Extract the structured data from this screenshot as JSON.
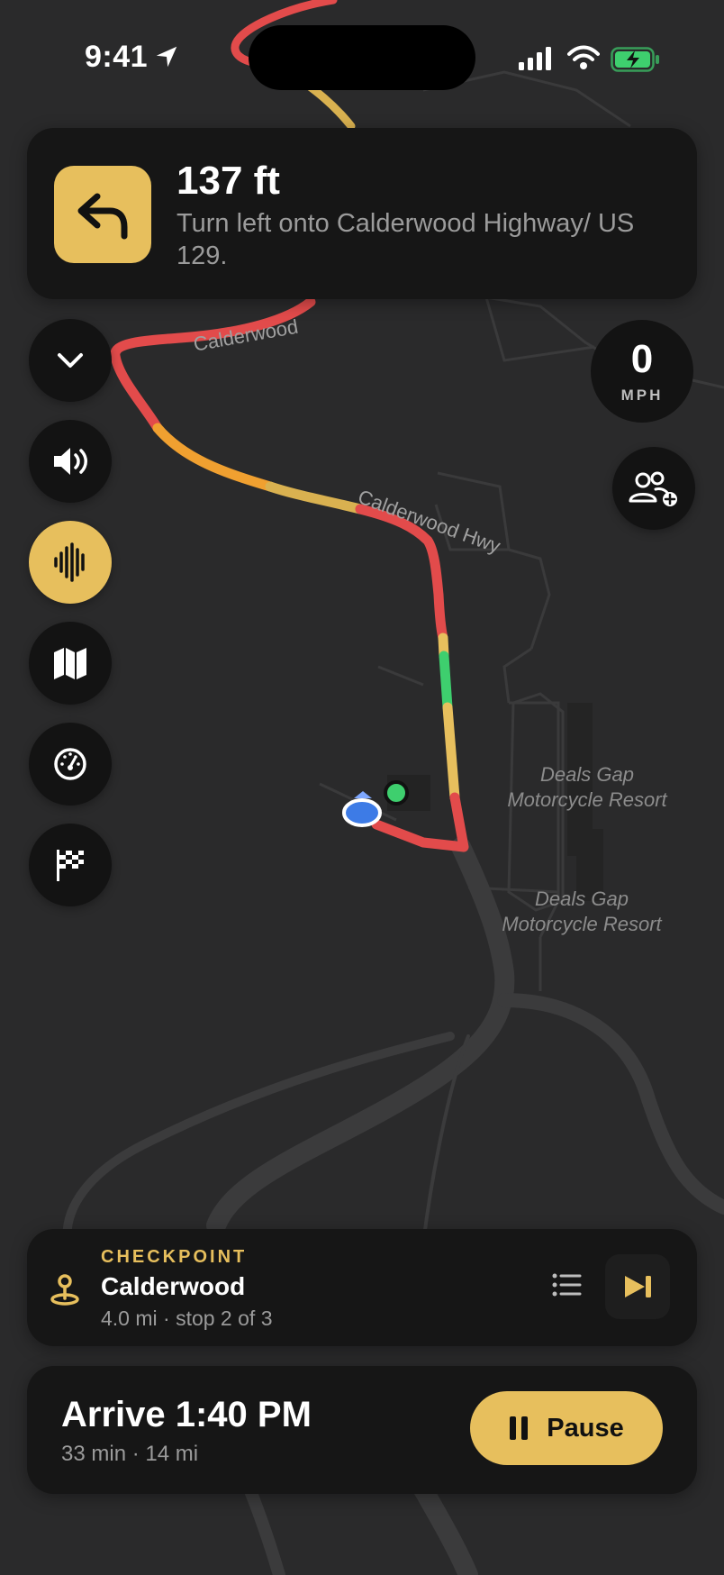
{
  "status_bar": {
    "time": "9:41",
    "icons": [
      "location-arrow-icon",
      "cellular-signal-icon",
      "wifi-icon",
      "battery-charging-icon"
    ]
  },
  "maneuver": {
    "icon": "turn-left-arrow-icon",
    "distance": "137 ft",
    "instruction": "Turn left onto Calderwood Highway/ US 129."
  },
  "map": {
    "road_labels": [
      "Calderwood",
      "Calderwood Hwy"
    ],
    "poi_labels": [
      {
        "line1": "Deals Gap",
        "line2": "Motorcycle Resort"
      },
      {
        "line1": "Deals Gap",
        "line2": "Motorcycle Resort"
      }
    ]
  },
  "controls": [
    {
      "name": "collapse-button",
      "icon": "chevron-down-icon",
      "active": false
    },
    {
      "name": "volume-button",
      "icon": "speaker-icon",
      "active": false
    },
    {
      "name": "voice-button",
      "icon": "waveform-icon",
      "active": true
    },
    {
      "name": "map-style-button",
      "icon": "map-icon",
      "active": false
    },
    {
      "name": "speedometer-button",
      "icon": "speedometer-icon",
      "active": false
    },
    {
      "name": "finish-flag-button",
      "icon": "checkered-flag-icon",
      "active": false
    }
  ],
  "speed": {
    "value": "0",
    "unit": "MPH"
  },
  "group": {
    "icon": "add-group-icon"
  },
  "checkpoint": {
    "eyebrow": "CHECKPOINT",
    "name": "Calderwood",
    "meta": "4.0 mi · stop 2 of 3"
  },
  "arrival": {
    "title": "Arrive 1:40 PM",
    "meta": "33 min · 14 mi",
    "pause_label": "Pause"
  },
  "colors": {
    "accent": "#e7bf5d",
    "route_red": "#e24b4b",
    "route_orange": "#f0a030",
    "route_yellow": "#e7bf5d",
    "route_green": "#3ecf6e",
    "user_dot": "#3d7be6"
  }
}
